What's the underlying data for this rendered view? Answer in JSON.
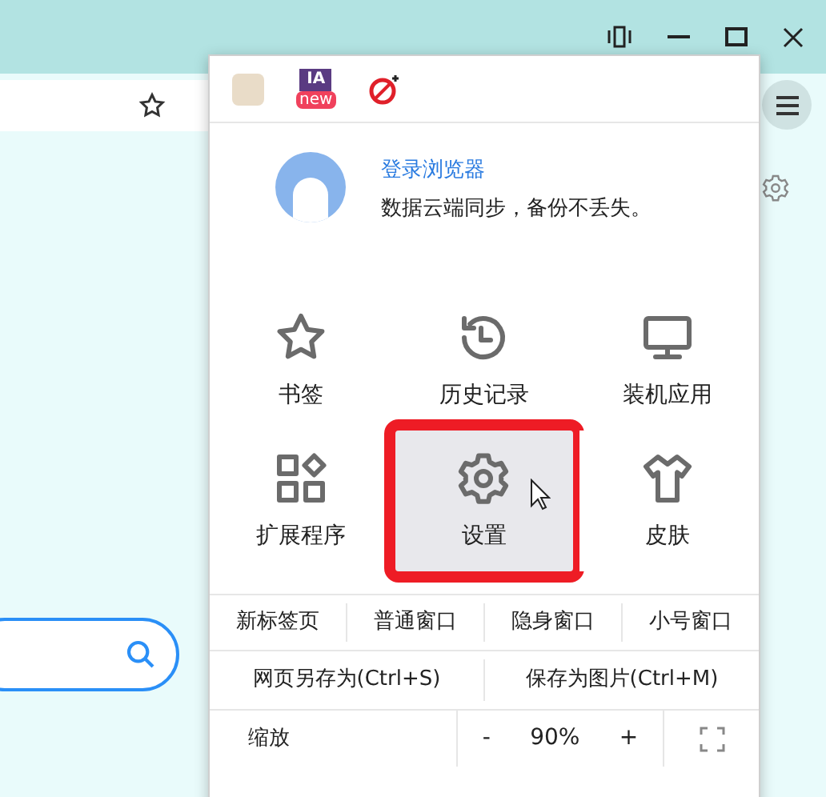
{
  "extensions": [
    {
      "kind": "avatar"
    },
    {
      "kind": "app",
      "label": "IA",
      "badge": "new"
    },
    {
      "kind": "blocker"
    }
  ],
  "account": {
    "link": "登录浏览器",
    "subtitle": "数据云端同步，备份不丢失。"
  },
  "tiles": [
    {
      "kind": "star",
      "label": "书签",
      "selected": false,
      "annotated": false
    },
    {
      "kind": "history",
      "label": "历史记录",
      "selected": false,
      "annotated": false
    },
    {
      "kind": "monitor",
      "label": "装机应用",
      "selected": false,
      "annotated": false
    },
    {
      "kind": "apps",
      "label": "扩展程序",
      "selected": false,
      "annotated": false
    },
    {
      "kind": "gear",
      "label": "设置",
      "selected": true,
      "annotated": true
    },
    {
      "kind": "shirt",
      "label": "皮肤",
      "selected": false,
      "annotated": false
    }
  ],
  "window_actions": [
    "新标签页",
    "普通窗口",
    "隐身窗口",
    "小号窗口"
  ],
  "save_actions": [
    "网页另存为(Ctrl+S)",
    "保存为图片(Ctrl+M)"
  ],
  "zoom": {
    "label": "缩放",
    "minus": "-",
    "value": "90%",
    "plus": "+"
  }
}
